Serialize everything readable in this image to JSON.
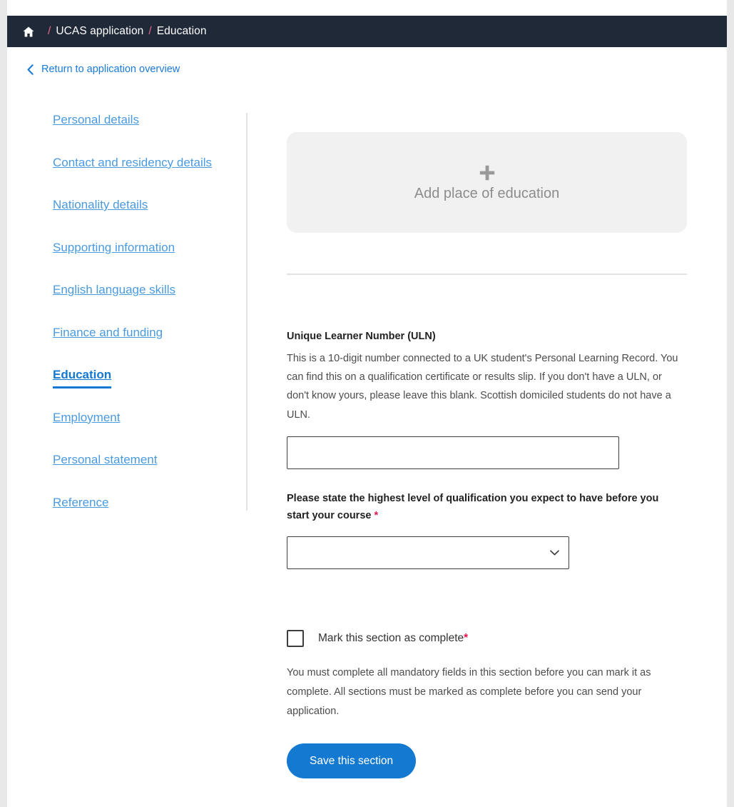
{
  "breadcrumb": {
    "home_icon": "home-icon",
    "separator": "/",
    "items": [
      "UCAS application",
      "Education"
    ]
  },
  "return_link": {
    "icon": "chevron-left-icon",
    "label": "Return to application overview"
  },
  "sidebar": {
    "items": [
      {
        "label": "Personal details",
        "active": false
      },
      {
        "label": "Contact and residency details",
        "active": false
      },
      {
        "label": "Nationality details",
        "active": false
      },
      {
        "label": "Supporting information",
        "active": false
      },
      {
        "label": "English language skills",
        "active": false
      },
      {
        "label": "Finance and funding",
        "active": false
      },
      {
        "label": "Education",
        "active": true
      },
      {
        "label": "Employment",
        "active": false
      },
      {
        "label": "Personal statement",
        "active": false
      },
      {
        "label": "Reference",
        "active": false
      }
    ]
  },
  "main": {
    "add_card": {
      "icon": "plus-icon",
      "label": "Add place of education"
    },
    "uln": {
      "label": "Unique Learner Number (ULN)",
      "help": "This is a 10-digit number connected to a UK student's Personal Learning Record. You can find this on a qualification certificate or results slip. If you don't have a ULN, or don't know yours, please leave this blank. Scottish domiciled students do not have a ULN.",
      "value": "",
      "placeholder": ""
    },
    "qualification": {
      "label": "Please state the highest level of qualification you expect to have before you start your course",
      "required_marker": "*",
      "selected": "",
      "icon": "chevron-down-icon",
      "options": [
        ""
      ]
    },
    "mark_complete": {
      "label": "Mark this section as complete",
      "required_marker": "*",
      "checked": false,
      "help": "You must complete all mandatory fields in this section before you can mark it as complete. All sections must be marked as complete before you can send your application."
    },
    "save_button": "Save this section"
  },
  "colors": {
    "breadcrumb_bg": "#1f2937",
    "breadcrumb_separator": "#ec6484",
    "link_blue": "#1a7ada",
    "sidebar_link": "#4a9ae0",
    "sidebar_active": "#1477d1",
    "card_bg": "#f1f1f1",
    "required_red": "#e8164d",
    "button_blue": "#1479d0"
  }
}
